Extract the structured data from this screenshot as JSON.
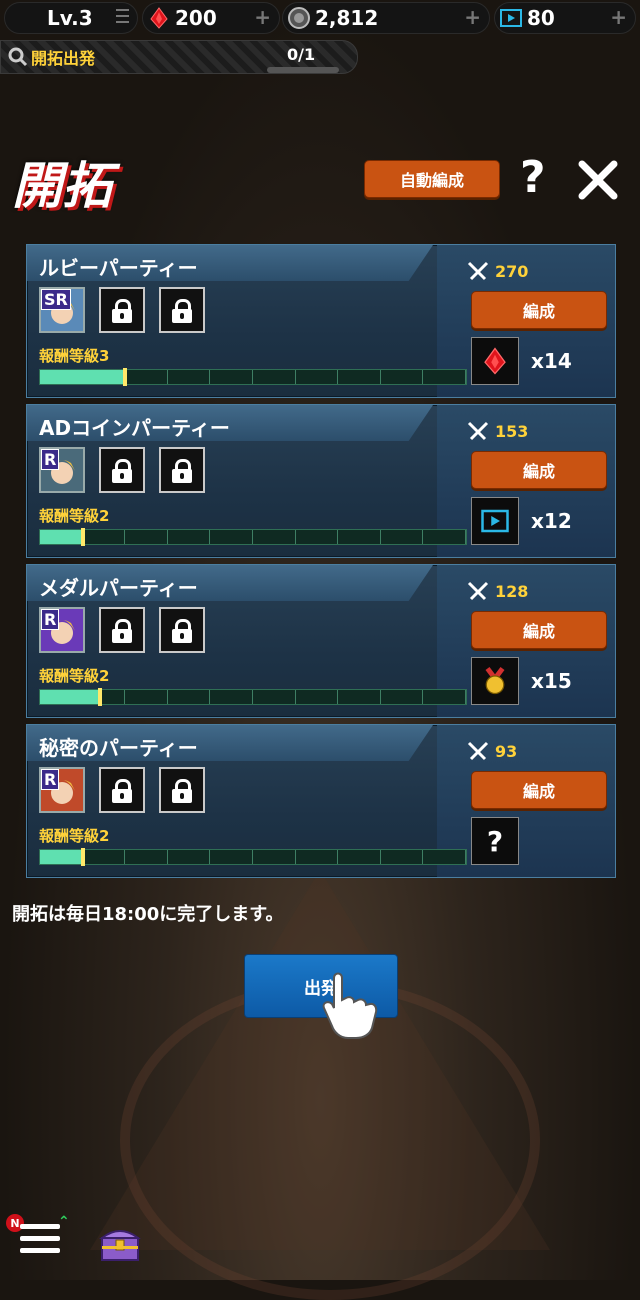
{
  "topbar": {
    "level": "Lv.3",
    "ruby": "200",
    "coin": "2,812",
    "ticket": "80",
    "plus": "+"
  },
  "search": {
    "label": "開拓出発",
    "count": "0/1"
  },
  "header": {
    "title": "開拓",
    "auto_button": "自動編成",
    "help": "?"
  },
  "parties": [
    {
      "name": "ルビーパーティー",
      "rank": "SR",
      "power": "270",
      "edit": "編成",
      "reward_level": "報酬等級3",
      "reward_icon": "ruby-icon",
      "reward_count": "x14",
      "progress": 0.2
    },
    {
      "name": "ADコインパーティー",
      "rank": "R",
      "power": "153",
      "edit": "編成",
      "reward_level": "報酬等級2",
      "reward_icon": "ticket-icon",
      "reward_count": "x12",
      "progress": 0.1
    },
    {
      "name": "メダルパーティー",
      "rank": "R",
      "power": "128",
      "edit": "編成",
      "reward_level": "報酬等級2",
      "reward_icon": "medal-icon",
      "reward_count": "x15",
      "progress": 0.14
    },
    {
      "name": "秘密のパーティー",
      "rank": "R",
      "power": "93",
      "edit": "編成",
      "reward_level": "報酬等級2",
      "reward_icon": "question-icon",
      "reward_count": "",
      "progress": 0.1
    }
  ],
  "note": "開拓は毎日18:00に完了します。",
  "depart_button": "出発",
  "bottom": {
    "badge": "N"
  },
  "colors": {
    "accent_orange": "#c95312",
    "depart_blue": "#1b79c9",
    "gold_text": "#ffd23a",
    "progress_fill": "#5fe0b0"
  }
}
